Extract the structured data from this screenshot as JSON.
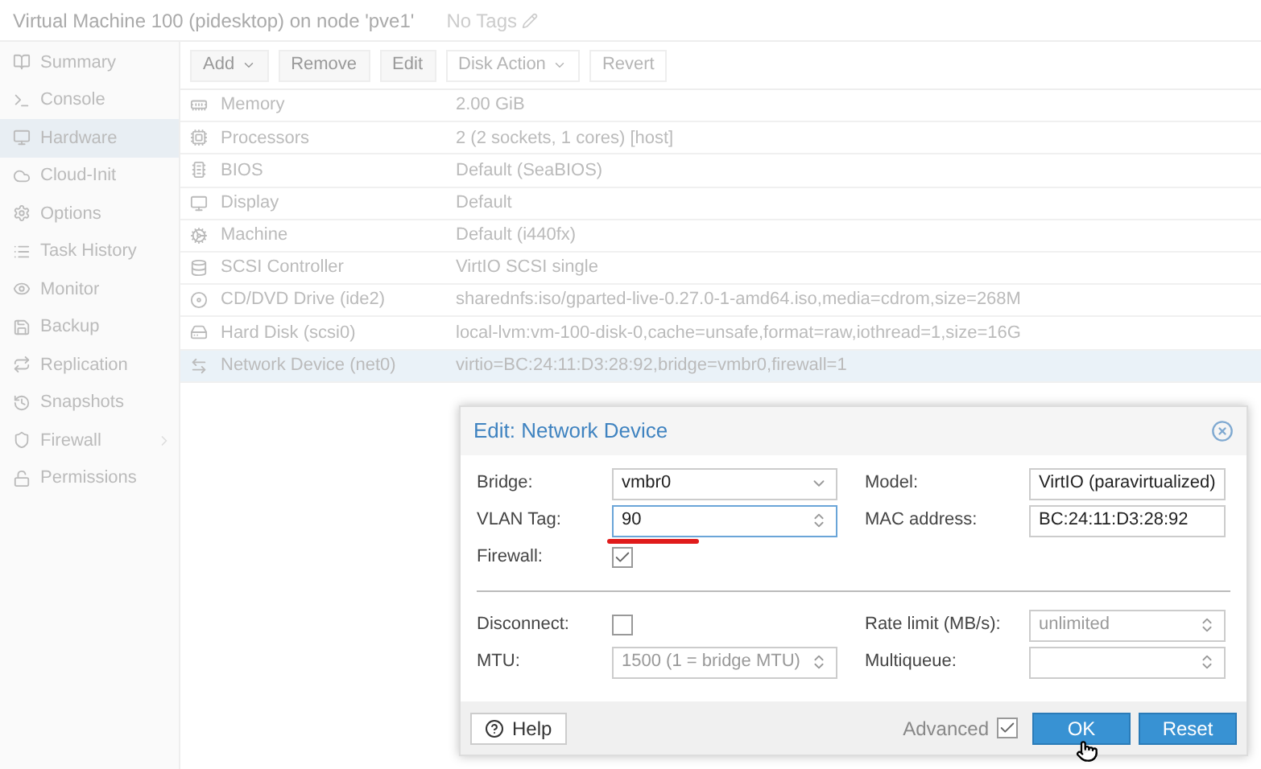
{
  "header": {
    "title": "Virtual Machine 100 (pidesktop) on node 'pve1'",
    "tags": "No Tags"
  },
  "sidebar": {
    "items": [
      {
        "label": "Summary",
        "selected": false,
        "has_submenu": false
      },
      {
        "label": "Console",
        "selected": false,
        "has_submenu": false
      },
      {
        "label": "Hardware",
        "selected": true,
        "has_submenu": false
      },
      {
        "label": "Cloud-Init",
        "selected": false,
        "has_submenu": false
      },
      {
        "label": "Options",
        "selected": false,
        "has_submenu": false
      },
      {
        "label": "Task History",
        "selected": false,
        "has_submenu": false
      },
      {
        "label": "Monitor",
        "selected": false,
        "has_submenu": false
      },
      {
        "label": "Backup",
        "selected": false,
        "has_submenu": false
      },
      {
        "label": "Replication",
        "selected": false,
        "has_submenu": false
      },
      {
        "label": "Snapshots",
        "selected": false,
        "has_submenu": false
      },
      {
        "label": "Firewall",
        "selected": false,
        "has_submenu": true
      },
      {
        "label": "Permissions",
        "selected": false,
        "has_submenu": false
      }
    ]
  },
  "toolbar": [
    {
      "label": "Add",
      "dropdown": true,
      "disabled": false
    },
    {
      "label": "Remove",
      "dropdown": false,
      "disabled": false
    },
    {
      "label": "Edit",
      "dropdown": false,
      "disabled": false
    },
    {
      "label": "Disk Action",
      "dropdown": true,
      "disabled": true
    },
    {
      "label": "Revert",
      "dropdown": false,
      "disabled": true
    }
  ],
  "hardware": [
    {
      "name": "Memory",
      "value": "2.00 GiB",
      "selected": false
    },
    {
      "name": "Processors",
      "value": "2 (2 sockets, 1 cores) [host]",
      "selected": false
    },
    {
      "name": "BIOS",
      "value": "Default (SeaBIOS)",
      "selected": false
    },
    {
      "name": "Display",
      "value": "Default",
      "selected": false
    },
    {
      "name": "Machine",
      "value": "Default (i440fx)",
      "selected": false
    },
    {
      "name": "SCSI Controller",
      "value": "VirtIO SCSI single",
      "selected": false
    },
    {
      "name": "CD/DVD Drive (ide2)",
      "value": "sharednfs:iso/gparted-live-0.27.0-1-amd64.iso,media=cdrom,size=268M",
      "selected": false
    },
    {
      "name": "Hard Disk (scsi0)",
      "value": "local-lvm:vm-100-disk-0,cache=unsafe,format=raw,iothread=1,size=16G",
      "selected": false
    },
    {
      "name": "Network Device (net0)",
      "value": "virtio=BC:24:11:D3:28:92,bridge=vmbr0,firewall=1",
      "selected": true
    }
  ],
  "dialog": {
    "title": "Edit: Network Device",
    "top_left": [
      {
        "kind": "combo",
        "label": "Bridge:",
        "value": "vmbr0"
      },
      {
        "kind": "spinner",
        "label": "VLAN Tag:",
        "value": "90",
        "focused": true
      },
      {
        "kind": "checkbox",
        "label": "Firewall:",
        "checked": true
      }
    ],
    "top_right": [
      {
        "kind": "combo",
        "label": "Model:",
        "value": "VirtIO (paravirtualized)"
      },
      {
        "kind": "text",
        "label": "MAC address:",
        "value": "BC:24:11:D3:28:92"
      }
    ],
    "bottom_left": [
      {
        "kind": "checkbox",
        "label": "Disconnect:",
        "checked": false
      },
      {
        "kind": "spinner",
        "label": "MTU:",
        "placeholder": "1500 (1 = bridge MTU)"
      }
    ],
    "bottom_right": [
      {
        "kind": "spinner",
        "label": "Rate limit (MB/s):",
        "placeholder": "unlimited"
      },
      {
        "kind": "spinner",
        "label": "Multiqueue:"
      }
    ],
    "help": "Help",
    "advanced": {
      "label": "Advanced",
      "checked": true
    },
    "ok": "OK",
    "reset": "Reset"
  }
}
